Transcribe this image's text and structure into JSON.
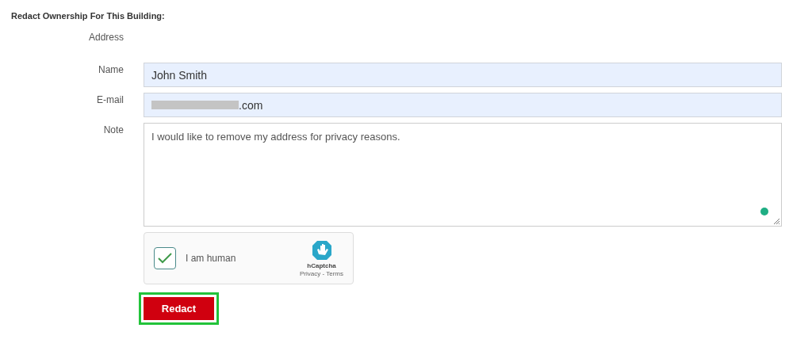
{
  "heading": "Redact Ownership For This Building:",
  "fields": [
    {
      "label": "Address",
      "kind": "static"
    },
    {
      "label": "Name",
      "kind": "input",
      "value": "John Smith"
    },
    {
      "label": "E-mail",
      "kind": "redacted-input",
      "value": ".com"
    },
    {
      "label": "Note",
      "kind": "textarea",
      "value": "I would like to remove my address for privacy reasons."
    }
  ],
  "captcha": {
    "label": "I am human",
    "checked": true,
    "brand": "hCaptcha",
    "links": "Privacy - Terms"
  },
  "submit": {
    "label": "Redact",
    "highlighted": true
  }
}
